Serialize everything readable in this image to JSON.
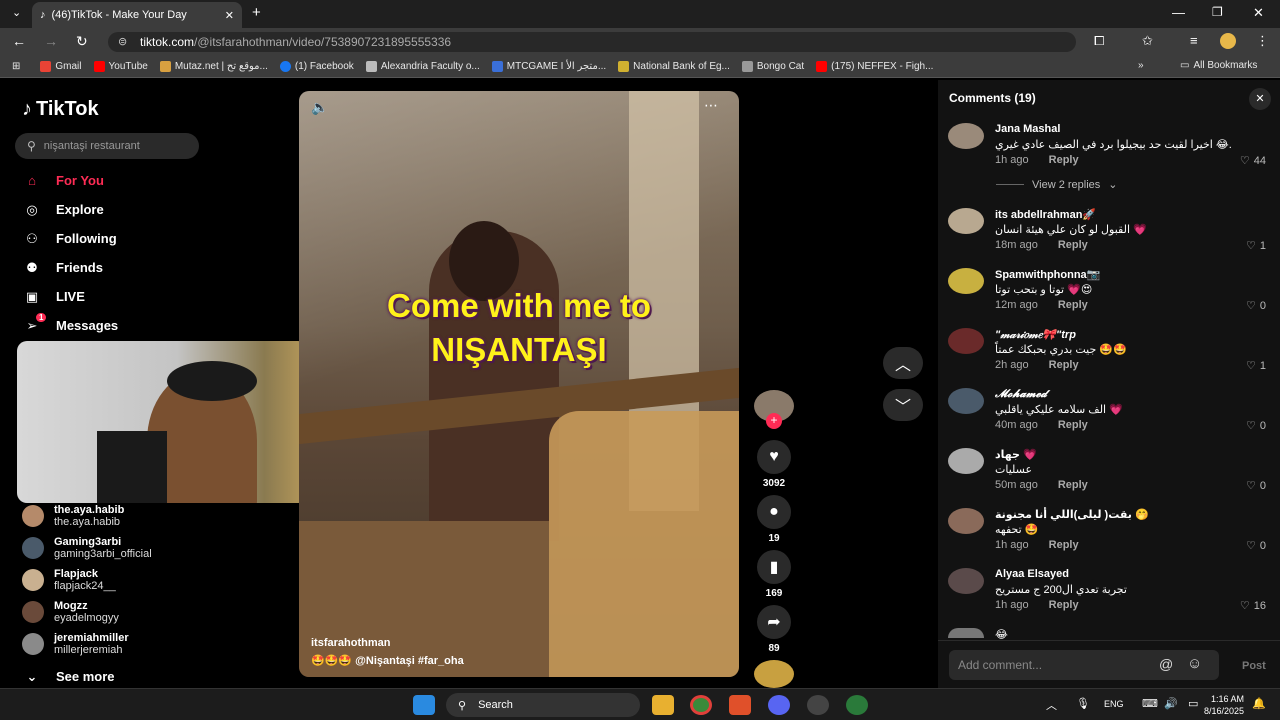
{
  "browser": {
    "tab_title": "(46)TikTok - Make Your Day",
    "url_host": "tiktok.com",
    "url_path": "/@itsfarahothman/video/7538907231895555336",
    "bookmarks": [
      "Gmail",
      "YouTube",
      "Mutaz.net | موقع تح...",
      "(1) Facebook",
      "Alexandria Faculty o...",
      "MTCGAME I متجر الأ...",
      "National Bank of Eg...",
      "Bongo Cat",
      "(175) NEFFEX - Figh..."
    ],
    "all_bookmarks": "All Bookmarks"
  },
  "tiktok": {
    "logo": "TikTok",
    "search_placeholder": "nişantaşi restaurant",
    "nav": [
      "For You",
      "Explore",
      "Following",
      "Friends",
      "LIVE",
      "Messages"
    ],
    "messages_badge": "1",
    "following_accounts": [
      {
        "name": "the.aya.habib",
        "handle": "the.aya.habib"
      },
      {
        "name": "Gaming3arbi",
        "handle": "gaming3arbi_official"
      },
      {
        "name": "Flapjack",
        "handle": "flapjack24__"
      },
      {
        "name": "Mogzz",
        "handle": "eyadelmogyy"
      },
      {
        "name": "jeremiahmiller",
        "handle": "millerjeremiah"
      }
    ],
    "see_more": "See more"
  },
  "video": {
    "caption_line1": "Come with me to",
    "caption_line2": "NIŞANTAŞI",
    "author": "itsfarahothman",
    "description": "🤩🤩🤩 @Nişantaşi  #far_oha",
    "likes": "3092",
    "comments": "19",
    "saves": "169",
    "shares": "89"
  },
  "comments_panel": {
    "title": "Comments (19)",
    "reply_label": "Reply",
    "view_replies": "View 2 replies",
    "add_placeholder": "Add comment...",
    "post_label": "Post",
    "items": [
      {
        "name": "Jana Mashal",
        "text": "اخيرا لقيت حد بيجيلوا برد في الصيف عادي غيري 😂.",
        "time": "1h ago",
        "likes": "44"
      },
      {
        "name": "its abdellrahman🚀",
        "text": "القبول لو كان علي هيئة انسان 💗",
        "time": "18m ago",
        "likes": "1"
      },
      {
        "name": "Spamwithphonna📷",
        "text": "توتا و بتحب توتا 💗😍",
        "time": "12m ago",
        "likes": "0"
      },
      {
        "name": "\"𝓂𝒶𝓇𝒾𝑜𝓂𝑒🎀\"trp",
        "text": "جيت بدري بحبكك عمتاً 🤩🤩",
        "time": "2h ago",
        "likes": "1"
      },
      {
        "name": "𝓜𝓸𝓱𝓪𝓶𝓮𝓭",
        "text": "الف سلامه عليكي ياقلبي 💗",
        "time": "40m ago",
        "likes": "0"
      },
      {
        "name": "جهاد 💗",
        "text": "عسليات",
        "time": "50m ago",
        "likes": "0"
      },
      {
        "name": "بقت( ليلى)اللي أنا مجنونة 🤭",
        "text": "تحفهه 🤩",
        "time": "1h ago",
        "likes": "0"
      },
      {
        "name": "Alyaa Elsayed",
        "text": "تجربة تعدي ال200 ج مستريح",
        "time": "1h ago",
        "likes": "16"
      }
    ],
    "partial_item_emoji": "😂"
  },
  "taskbar": {
    "search": "Search",
    "lang": "ENG",
    "time": "1:16 AM",
    "date": "8/16/2025"
  },
  "colors": {
    "accent": "#fe2c55",
    "link": "#25f4ee"
  }
}
